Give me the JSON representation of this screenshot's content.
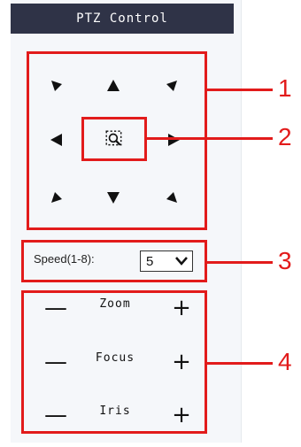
{
  "header": {
    "title": "PTZ Control"
  },
  "ptz": {
    "directions": [
      "up-left",
      "up",
      "up-right",
      "left",
      "center",
      "right",
      "down-left",
      "down",
      "down-right"
    ]
  },
  "speed": {
    "label": "Speed(1-8):",
    "value": "5"
  },
  "controls": [
    {
      "label": "Zoom",
      "minus": "—",
      "plus": "+"
    },
    {
      "label": "Focus",
      "minus": "—",
      "plus": "+"
    },
    {
      "label": "Iris",
      "minus": "—",
      "plus": "+"
    }
  ],
  "callouts": [
    "1",
    "2",
    "3",
    "4"
  ],
  "colors": {
    "header_bg": "#2f3347",
    "callout": "#e21b1b"
  }
}
